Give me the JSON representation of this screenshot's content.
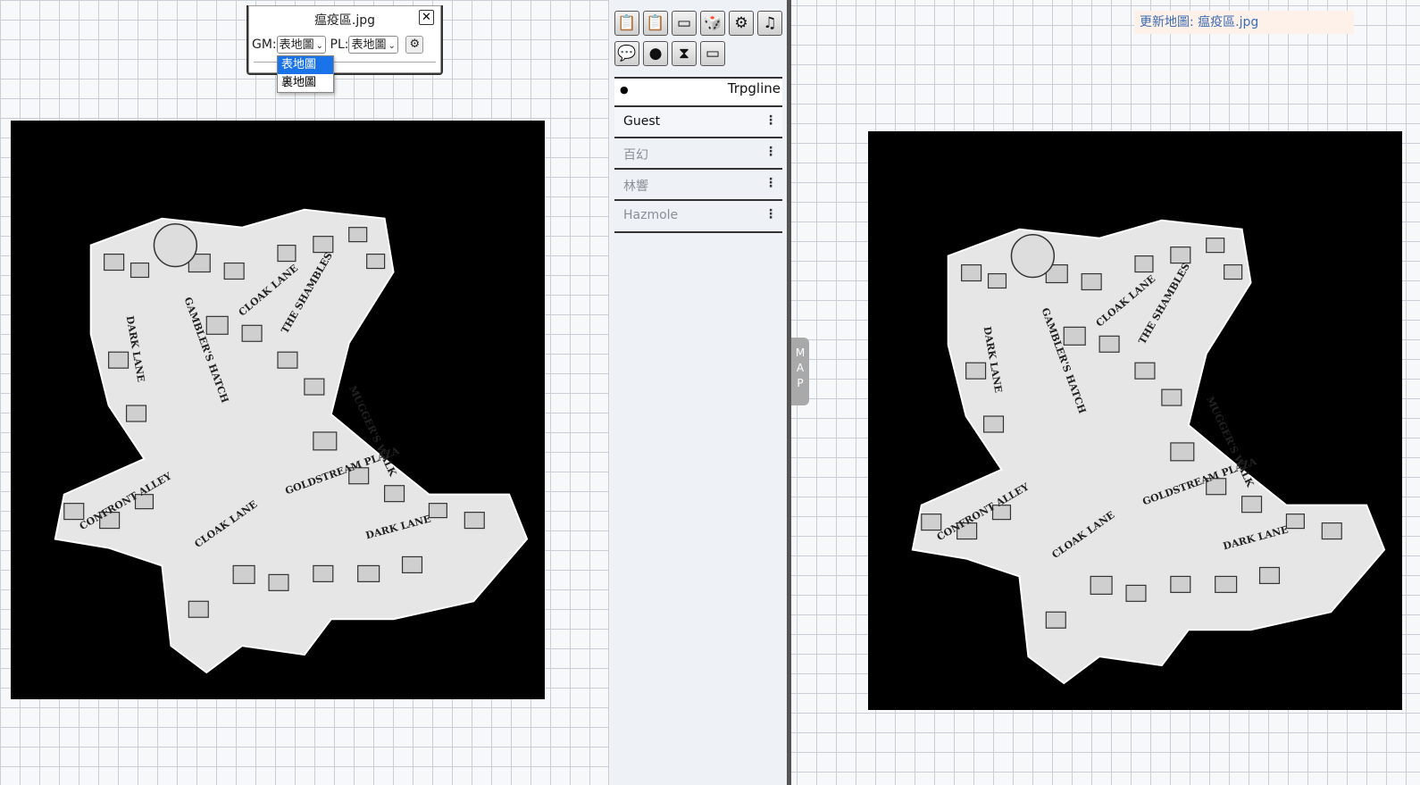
{
  "map_window": {
    "title": "瘟疫區.jpg",
    "close_label": "✕",
    "gm_label": "GM:",
    "gm_value": "表地圖",
    "pl_label": "PL:",
    "pl_value": "表地圖",
    "dropdown_options": [
      "表地圖",
      "裏地圖"
    ],
    "selected_option": "表地圖"
  },
  "panel": {
    "tools": [
      {
        "icon": "clipboard-check-icon",
        "glyph": "📋"
      },
      {
        "icon": "clipboard-icon",
        "glyph": "📋"
      },
      {
        "icon": "box-icon",
        "glyph": "▭"
      },
      {
        "icon": "dice-icon",
        "glyph": "🎲"
      },
      {
        "icon": "gear-icon",
        "glyph": "⚙"
      },
      {
        "icon": "music-icon",
        "glyph": "♫"
      },
      {
        "icon": "chat-icon",
        "glyph": "💬"
      },
      {
        "icon": "character-icon",
        "glyph": "●"
      },
      {
        "icon": "hourglass-icon",
        "glyph": "⧗"
      },
      {
        "icon": "screen-icon",
        "glyph": "▭"
      }
    ],
    "room_name": "Trpgline",
    "users": [
      {
        "name": "Guest",
        "active": true
      },
      {
        "name": "百幻",
        "active": false
      },
      {
        "name": "林響",
        "active": false
      },
      {
        "name": "Hazmole",
        "active": false
      }
    ],
    "kebab": "⋮"
  },
  "map_tab": [
    "M",
    "A",
    "P"
  ],
  "notice": "更新地圖: 瘟疫區.jpg",
  "map_labels": [
    "DARK LANE",
    "GAMBLER'S HATCH",
    "CLOAK LANE",
    "THE SHAMBLES",
    "MUGGER'S WALK",
    "GOLDSTREAM PLAZA",
    "CONFRONT ALLEY",
    "CLOAK LANE",
    "DARK LANE"
  ],
  "colors": {
    "accent": "#1a73e8",
    "notice_text": "#3d6cb0",
    "notice_bg": "#fdf1ea"
  }
}
